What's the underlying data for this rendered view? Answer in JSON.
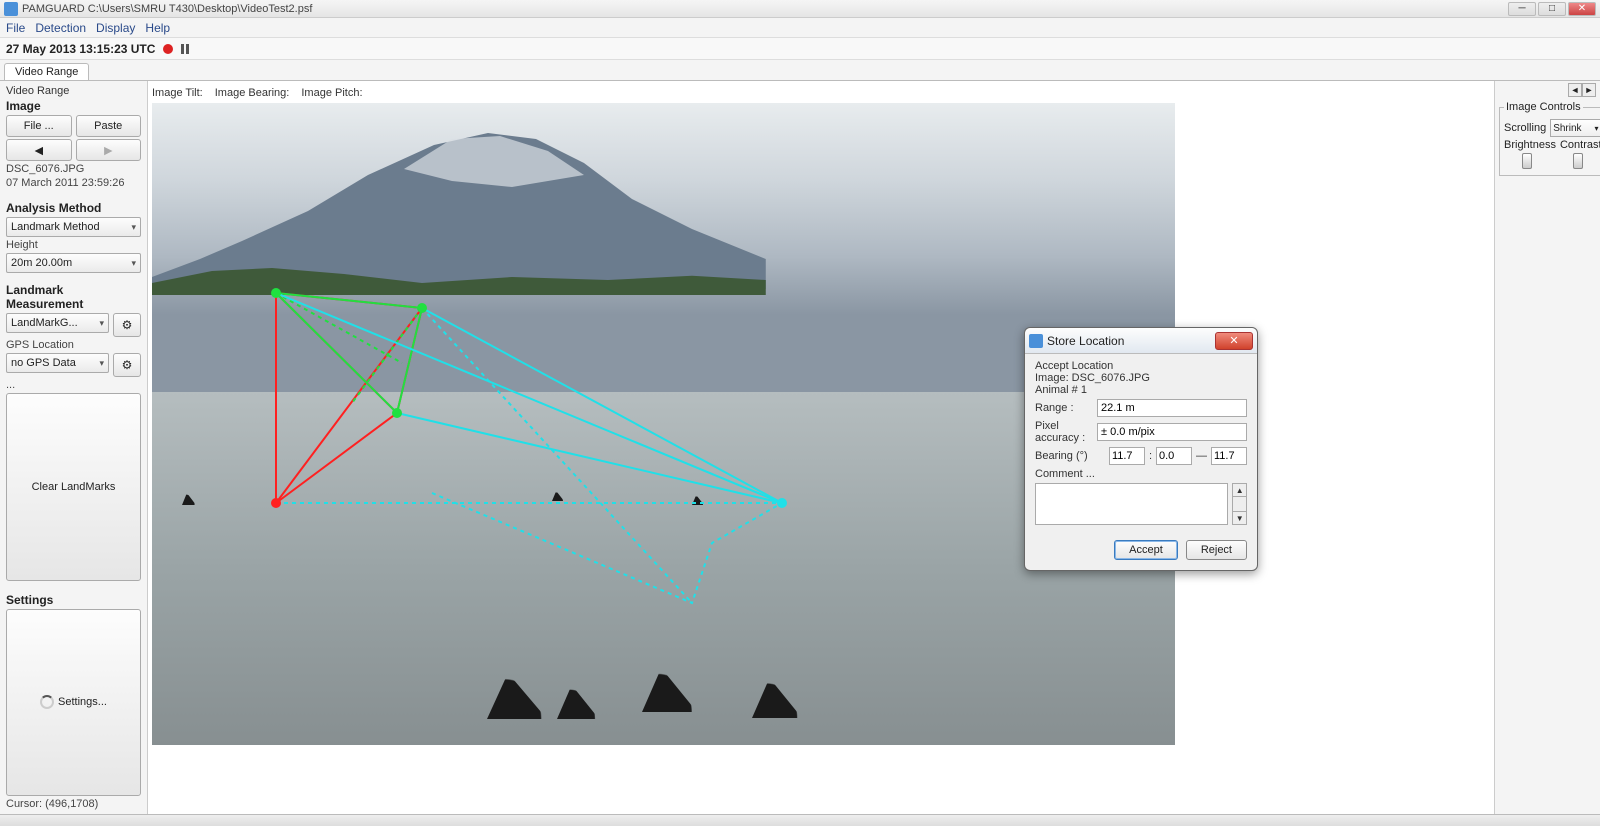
{
  "app": {
    "name": "PAMGUARD",
    "path": "C:\\Users\\SMRU T430\\Desktop\\VideoTest2.psf",
    "title": "PAMGUARD    C:\\Users\\SMRU T430\\Desktop\\VideoTest2.psf"
  },
  "menu": [
    "File",
    "Detection",
    "Display",
    "Help"
  ],
  "timebar": "27 May 2013 13:15:23 UTC",
  "tab": "Video Range",
  "sidebar": {
    "section_label": "Video Range",
    "image_heading": "Image",
    "file_btn": "File ...",
    "paste_btn": "Paste",
    "prev": "◄",
    "next": "►",
    "filename": "DSC_6076.JPG",
    "filedate": "07 March 2011 23:59:26",
    "analysis_heading": "Analysis Method",
    "analysis_value": "Landmark Method",
    "height_label": "Height",
    "height_value": "20m 20.00m",
    "landmark_heading": "Landmark Measurement",
    "landmark_value": "LandMarkG...",
    "gps_label": "GPS Location",
    "gps_value": "no GPS Data",
    "dots": "...",
    "clear_btn": "Clear LandMarks",
    "settings_heading": "Settings",
    "settings_btn": "Settings...",
    "cursor": "Cursor: (496,1708)"
  },
  "viewer": {
    "tilt": "Image Tilt:",
    "bearing": "Image Bearing:",
    "pitch": "Image Pitch:"
  },
  "right": {
    "group": "Image Controls",
    "scrolling": "Scrolling",
    "shrink": "Shrink",
    "brightness": "Brightness",
    "contrast": "Contrast"
  },
  "dialog": {
    "title": "Store Location",
    "accept_location": "Accept Location",
    "image_line": "Image: DSC_6076.JPG",
    "animal_line": "Animal # 1",
    "range_lbl": "Range :",
    "range_val": "22.1 m",
    "pix_lbl": "Pixel accuracy :",
    "pix_val": "± 0.0 m/pix",
    "bearing_lbl": "Bearing (°)",
    "bearing_a": "11.7",
    "bearing_sep1": ":",
    "bearing_b": "0.0",
    "bearing_sep2": "—",
    "bearing_c": "11.7",
    "comment_lbl": "Comment ...",
    "accept": "Accept",
    "reject": "Reject"
  }
}
